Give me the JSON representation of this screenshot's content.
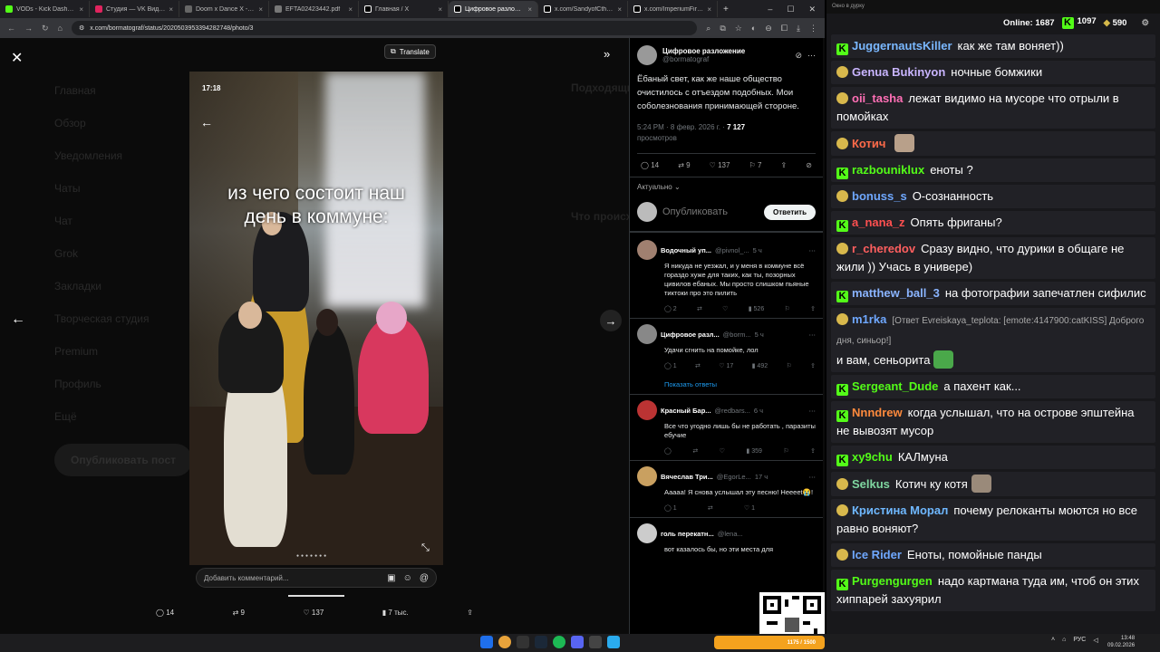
{
  "browser": {
    "tabs": [
      {
        "label": "VODs - Kick Dashboard",
        "color": "#53fc18"
      },
      {
        "label": "Студия — VK Видео Li...",
        "color": "#e0245e"
      },
      {
        "label": "Doom x Dance X - live...",
        "color": "#666"
      },
      {
        "label": "EFTA02423442.pdf",
        "color": "#777"
      },
      {
        "label": "Главная / X",
        "color": "#000"
      },
      {
        "label": "Цифровое разложени...",
        "color": "#000"
      },
      {
        "label": "x.com/SandyofCthulh...",
        "color": "#000"
      },
      {
        "label": "x.com/ImperiumFirst/st...",
        "color": "#000"
      }
    ],
    "url": "x.com/bormatograf/status/2020503953394282748/photo/3"
  },
  "viewer": {
    "translate_label": "Translate",
    "photo_time": "17:18",
    "caption": "из чего состоит наш день в коммуне:",
    "comment_placeholder": "Добавить комментарий...",
    "stats": {
      "replies": "14",
      "reposts": "9",
      "likes": "137",
      "views": "7 тыс."
    }
  },
  "background_nav": [
    "Главная",
    "Обзор",
    "Уведомления",
    "Чаты",
    "Чат",
    "Grok",
    "Закладки",
    "Творческая студия",
    "Premium",
    "Профиль",
    "Ещё"
  ],
  "background_post_button": "Опубликовать пост",
  "background_right": {
    "heading1": "Подходящие",
    "heading2": "Что происходит"
  },
  "tweet": {
    "author": "Цифровое разложение",
    "handle": "@bormatograf",
    "text": "Ёбаный свет, как же наше общество очистилось с отъездом подобных. Мои соболезнования принимающей стороне.",
    "time": "5:24 PM · 8 февр. 2026 г. ·",
    "views": "7 127",
    "views_label": "просмотров",
    "actions": {
      "replies": "14",
      "reposts": "9",
      "likes": "137",
      "bookmarks": "7"
    },
    "sort": "Актуально",
    "reply_placeholder": "Опубликовать",
    "reply_button": "Ответить",
    "replies": [
      {
        "name": "Водочный уп...",
        "handle": "@pivnol_...",
        "time": "5 ч",
        "text": "Я никуда не уезжал, и у меня в коммуне всё гораздо хуже для таких, как ты, позорных цивилов ебаных. Мы просто слишком пьяные тиктоки про это пилить",
        "r": "2",
        "rt": "",
        "l": "",
        "v": "526",
        "avatar": "#a08070"
      },
      {
        "name": "Цифровое разл...",
        "handle": "@borm...",
        "time": "5 ч",
        "text": "Удачи сгнить на помойке, лол",
        "r": "1",
        "rt": "",
        "l": "17",
        "v": "492",
        "avatar": "#888",
        "show_replies": "Показать ответы"
      },
      {
        "name": "Красный Бар...",
        "handle": "@redbars...",
        "time": "6 ч",
        "text": "Все что угодно лишь бы не работать , паразиты ебучие",
        "r": "",
        "rt": "",
        "l": "",
        "v": "359",
        "avatar": "#b33"
      },
      {
        "name": "Вячеслав Три...",
        "handle": "@EgorLe...",
        "time": "17 ч",
        "text": "Ааааа! Я снова услышал эту песню! Нееееt😭!",
        "r": "1",
        "rt": "",
        "l": "1",
        "v": "",
        "avatar": "#c9a060"
      },
      {
        "name": "голь перекатн...",
        "handle": "@lena...",
        "time": "",
        "text": "вот казалось бы, но эти места для",
        "r": "",
        "rt": "",
        "l": "",
        "v": "",
        "avatar": "#ccc"
      }
    ]
  },
  "chat": {
    "window_title": "Окно в дурку",
    "online_label": "Online:",
    "online": "1687",
    "kick_count": "1097",
    "other_count": "590",
    "messages": [
      {
        "name": "JuggernautsKiller",
        "color": "#7ab8ff",
        "text": "как же там воняет))",
        "badge": "k"
      },
      {
        "name": "Genua Bukinyon",
        "color": "#c9b5ff",
        "text": "ночные бомжики",
        "badge": "p"
      },
      {
        "name": "oii_tasha",
        "color": "#ff6fb5",
        "text": "лежат видимо на мусоре что отрыли в помойках",
        "badge": "p"
      },
      {
        "name": "Котич",
        "color": "#ff6b4a",
        "text": "",
        "badge": "p"
      },
      {
        "name": "razbouniklux",
        "color": "#53fc18",
        "text": "еноты ?",
        "badge": "k"
      },
      {
        "name": "bonuss_s",
        "color": "#6fa8ff",
        "text": "О-сознанность",
        "badge": "p"
      },
      {
        "name": "a_nana_z",
        "color": "#ff5050",
        "text": "Опять фриганы?",
        "badge": "k"
      },
      {
        "name": "r_cheredov",
        "color": "#ff5f5f",
        "text": "Сразу видно, что дурики в общаге не жили )) Учась в универе)",
        "badge": "p"
      },
      {
        "name": "matthew_ball_3",
        "color": "#8ab4ff",
        "text": "на фотографии запечатлен сифилис",
        "badge": "k"
      },
      {
        "name": "m1rka",
        "color": "#6fa8ff",
        "text": "и вам, сеньорита",
        "reply": "[Ответ Evreiskaya_teplota: [emote:4147900:catKISS] Доброго дня, синьор!]",
        "badge": "p"
      },
      {
        "name": "Sergeant_Dude",
        "color": "#53fc18",
        "text": "а пахент как...",
        "badge": "k"
      },
      {
        "name": "Nnndrew",
        "color": "#ff8a3d",
        "text": "когда услышал, что на острове эпштейна не вывозят мусор",
        "badge": "k"
      },
      {
        "name": "xy9chu",
        "color": "#53fc18",
        "text": "КАЛмуна",
        "badge": "k"
      },
      {
        "name": "Selkus",
        "color": "#7fd6a0",
        "text": "Котич ку котя",
        "badge": "p"
      },
      {
        "name": "Кристина Морал",
        "color": "#6fb8ff",
        "text": "почему релоканты моются но все равно воняют?",
        "badge": "p"
      },
      {
        "name": "Ice Rider",
        "color": "#6fa8ff",
        "text": "Еноты, помойные панды",
        "badge": "p"
      },
      {
        "name": "Purgengurgen",
        "color": "#53fc18",
        "text": "надо картмана туда им, чтоб он этих хиппарей захуярил",
        "badge": "k"
      }
    ]
  },
  "taskbar": {
    "time": "13:48",
    "date": "09.02.2026",
    "lang": "РУС",
    "widget": "1175 / 1500"
  }
}
